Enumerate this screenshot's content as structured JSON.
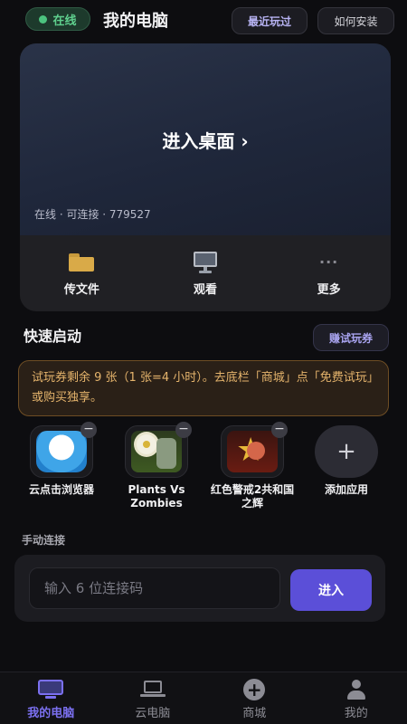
{
  "header": {
    "status": "在线",
    "title": "我的电脑",
    "recent_label": "最近玩过",
    "howto_label": "如何安装"
  },
  "desktop": {
    "enter_label": "进入桌面 ›",
    "status_line": "在线 · 可连接 · 779527",
    "actions": [
      {
        "label": "传文件",
        "icon": "folder-icon"
      },
      {
        "label": "观看",
        "icon": "monitor-icon"
      },
      {
        "label": "更多",
        "icon": "more-icon"
      }
    ]
  },
  "quick_start": {
    "title": "快速启动",
    "earn_label": "赚试玩券",
    "notice": "试玩券剩余 9 张（1 张=4 小时）。去底栏「商城」点「免费试玩」或购买独享。",
    "apps": [
      {
        "name": "云点击浏览器",
        "icon": "cloud-browser-icon"
      },
      {
        "name": "Plants Vs Zombies",
        "icon": "plants-vs-zombies-icon"
      },
      {
        "name": "红色警戒2共和国之辉",
        "icon": "red-alert-icon"
      }
    ],
    "add_label": "添加应用",
    "remove_symbol": "−"
  },
  "manual": {
    "label": "手动连接",
    "input_placeholder": "输入 6 位连接码",
    "input_value": "",
    "enter_label": "进入"
  },
  "nav": {
    "items": [
      {
        "label": "我的电脑",
        "icon": "monitor-icon",
        "active": true
      },
      {
        "label": "云电脑",
        "icon": "laptop-icon",
        "active": false
      },
      {
        "label": "商城",
        "icon": "plus-circle-icon",
        "active": false
      },
      {
        "label": "我的",
        "icon": "user-icon",
        "active": false
      }
    ]
  },
  "colors": {
    "accent": "#5b4fd8",
    "online_green": "#4cc47f",
    "notice_text": "#e5b46c",
    "background": "#0d0d10"
  }
}
